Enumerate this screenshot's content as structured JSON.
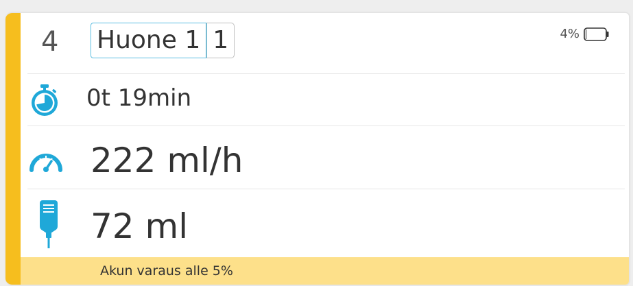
{
  "colors": {
    "accent": "#f6be1e",
    "icon_blue": "#1fa8d8",
    "warning_bg": "#fde08a",
    "room_border": "#5bbde0"
  },
  "pump": {
    "number": "4",
    "room_name": "Huone 1",
    "bed": "1",
    "battery_percent": "4%",
    "battery_level": 0.04
  },
  "time_remaining": {
    "icon": "stopwatch-icon",
    "value": "0t 19min"
  },
  "rate": {
    "icon": "speedometer-icon",
    "value": "222 ml/h"
  },
  "volume": {
    "icon": "infusion-bag-icon",
    "value": "72 ml"
  },
  "warning": {
    "text": "Akun varaus alle 5%"
  }
}
